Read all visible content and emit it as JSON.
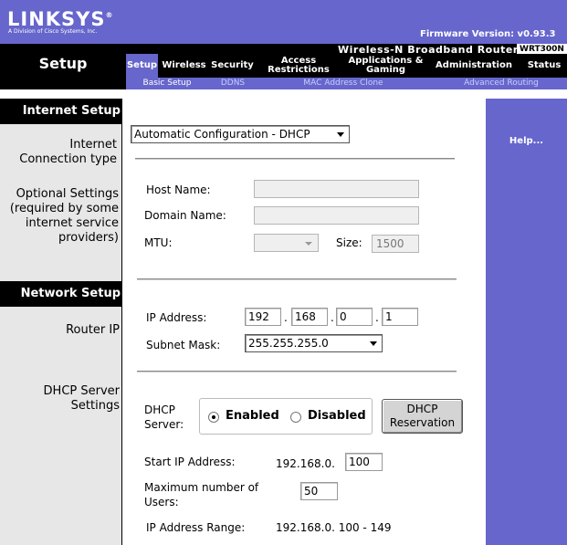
{
  "brand": {
    "logo": "LINKSYS",
    "registered": "®",
    "subtitle": "A Division of Cisco Systems, Inc.",
    "firmware": "Firmware Version: v0.93.3",
    "product_name": "Wireless-N Broadband Router",
    "model": "WRT300N"
  },
  "page_title": "Setup",
  "tabs": [
    {
      "label": "Setup",
      "active": true
    },
    {
      "label": "Wireless"
    },
    {
      "label": "Security"
    },
    {
      "label": "Access Restrictions"
    },
    {
      "label": "Applications & Gaming"
    },
    {
      "label": "Administration"
    },
    {
      "label": "Status"
    }
  ],
  "subtabs": [
    {
      "label": "Basic Setup",
      "active": true
    },
    {
      "label": "DDNS"
    },
    {
      "label": "MAC Address Clone"
    },
    {
      "label": "Advanced Routing"
    }
  ],
  "sections": {
    "internet_setup": "Internet Setup",
    "network_setup": "Network Setup"
  },
  "labels": {
    "connection_type": "Internet Connection type",
    "optional_settings": "Optional Settings (required by some internet service providers)",
    "router_ip": "Router IP",
    "dhcp_settings": "DHCP Server Settings"
  },
  "internet": {
    "connection_type": "Automatic Configuration - DHCP",
    "host_name_label": "Host Name:",
    "host_name": "",
    "domain_name_label": "Domain Name:",
    "domain_name": "",
    "mtu_label": "MTU:",
    "mtu": "",
    "size_label": "Size:",
    "size": "1500"
  },
  "network": {
    "ip_label": "IP Address:",
    "ip": [
      "192",
      "168",
      "0",
      "1"
    ],
    "ip_separator": ".",
    "mask_label": "Subnet Mask:",
    "mask": "255.255.255.0"
  },
  "dhcp": {
    "server_label": "DHCP Server:",
    "enabled_label": "Enabled",
    "disabled_label": "Disabled",
    "selected": "Enabled",
    "reservation_button": "DHCP Reservation",
    "start_label": "Start IP Address:",
    "start_prefix": "192.168.0.",
    "start_value": "100",
    "max_users_label": "Maximum number of Users:",
    "max_users": "50",
    "range_label": "IP Address Range:",
    "range_value": "192.168.0. 100 - 149"
  },
  "help": "Help...",
  "colors": {
    "accent": "#6666cc",
    "bar": "#000000",
    "left_column": "#e7e7e7"
  }
}
